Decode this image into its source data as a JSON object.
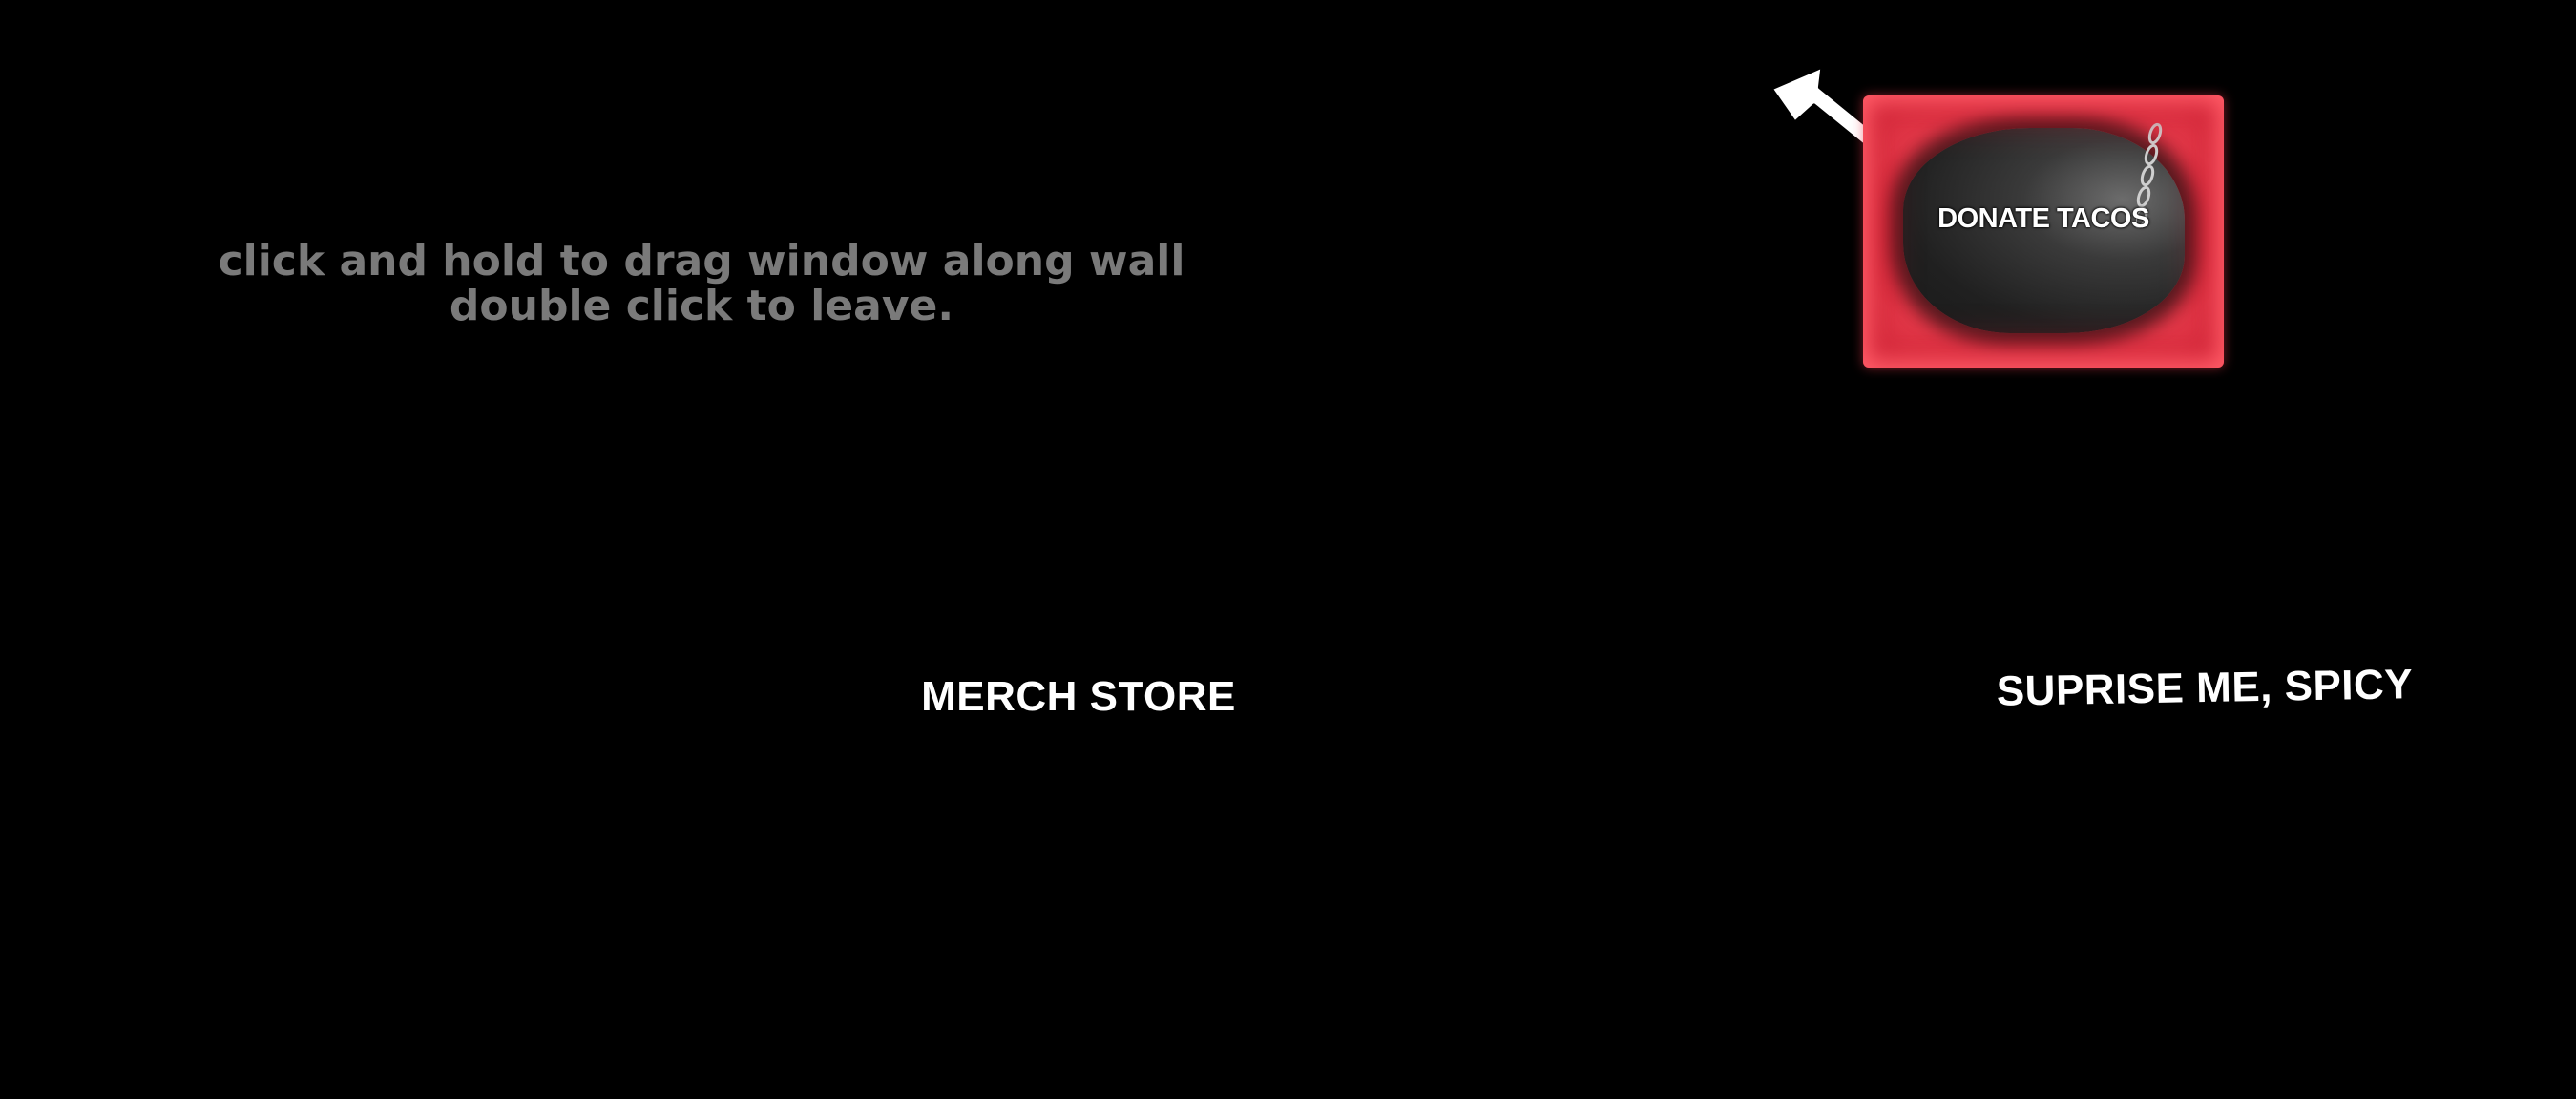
{
  "instructions": {
    "line1": "click and hold to drag window along wall",
    "line2": "double click to leave."
  },
  "donate": {
    "label": "DONATE TACOS",
    "frame_color": "#d92a3b",
    "pointer_icon": "arrow-pointer-icon"
  },
  "links": {
    "merch": "MERCH STORE",
    "spicy": "SUPRISE ME, SPICY"
  },
  "colors": {
    "background": "#000000",
    "instruction_text": "#7a7a7a",
    "link_text": "#ffffff"
  }
}
